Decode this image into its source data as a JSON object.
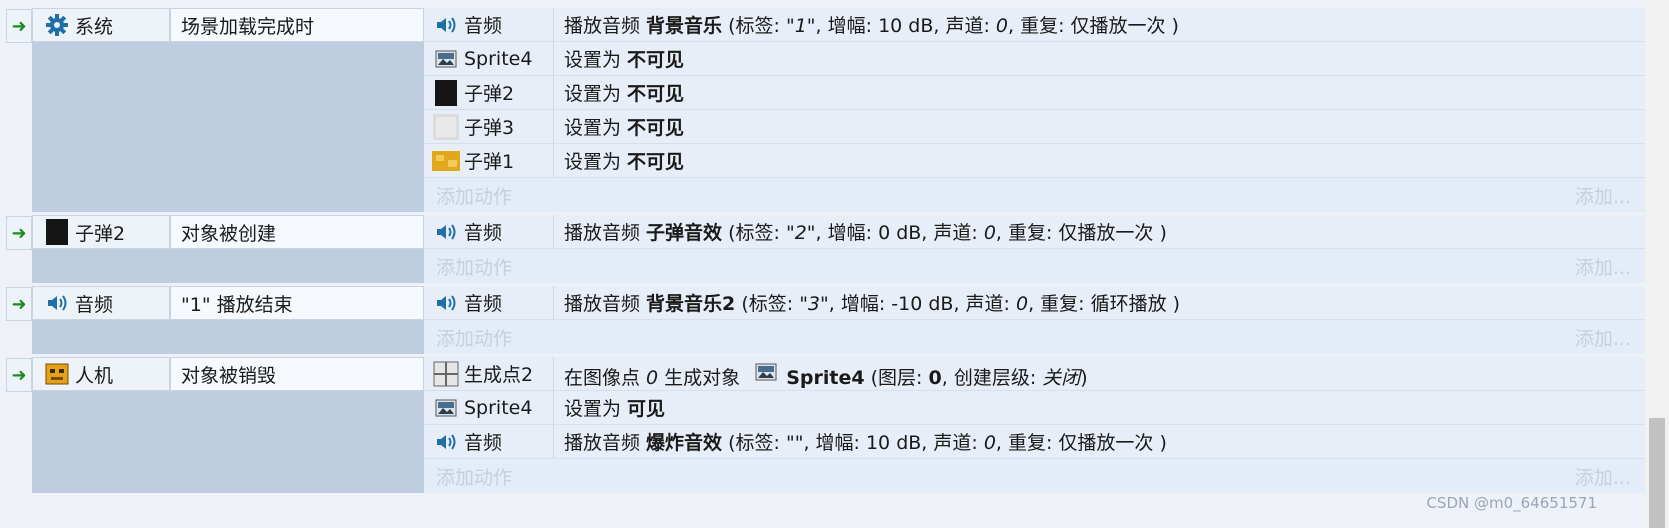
{
  "events": [
    {
      "object": "系统",
      "object_icon": "gear-icon",
      "condition": "场景加载完成时",
      "actions": [
        {
          "object": "音频",
          "icon": "speaker-icon",
          "parts": [
            {
              "t": "播放音频 "
            },
            {
              "b": "背景音乐"
            },
            {
              "t": " (标签: "
            },
            {
              "i": "\"1\""
            },
            {
              "t": ", 增幅: 10 dB, 声道: "
            },
            {
              "i": "0"
            },
            {
              "t": ", 重复: 仅播放一次 )"
            }
          ]
        },
        {
          "object": "Sprite4",
          "icon": "sprite-icon",
          "parts": [
            {
              "t": "设置为 "
            },
            {
              "b": "不可见"
            }
          ]
        },
        {
          "object": "子弹2",
          "icon": "black-square-icon",
          "parts": [
            {
              "t": "设置为 "
            },
            {
              "b": "不可见"
            }
          ]
        },
        {
          "object": "子弹3",
          "icon": "grey-square-icon",
          "parts": [
            {
              "t": "设置为 "
            },
            {
              "b": "不可见"
            }
          ]
        },
        {
          "object": "子弹1",
          "icon": "gold-square-icon",
          "parts": [
            {
              "t": "设置为 "
            },
            {
              "b": "不可见"
            }
          ]
        }
      ]
    },
    {
      "object": "子弹2",
      "object_icon": "black-square-icon",
      "condition": "对象被创建",
      "actions": [
        {
          "object": "音频",
          "icon": "speaker-icon",
          "parts": [
            {
              "t": "播放音频 "
            },
            {
              "b": "子弹音效"
            },
            {
              "t": " (标签: "
            },
            {
              "i": "\"2\""
            },
            {
              "t": ", 增幅: 0 dB, 声道: "
            },
            {
              "i": "0"
            },
            {
              "t": ", 重复: 仅播放一次 )"
            }
          ]
        }
      ]
    },
    {
      "object": "音频",
      "object_icon": "speaker-icon",
      "condition": "\"1\" 播放结束",
      "actions": [
        {
          "object": "音频",
          "icon": "speaker-icon",
          "parts": [
            {
              "t": "播放音频 "
            },
            {
              "b": "背景音乐2"
            },
            {
              "t": " (标签: "
            },
            {
              "i": "\"3\""
            },
            {
              "t": ", 增幅: -10 dB, 声道: "
            },
            {
              "i": "0"
            },
            {
              "t": ", 重复: 循环播放 )"
            }
          ]
        }
      ]
    },
    {
      "object": "人机",
      "object_icon": "robot-icon",
      "condition": "对象被销毁",
      "actions": [
        {
          "object": "生成点2",
          "icon": "grid-icon",
          "parts": [
            {
              "t": "在图像点 "
            },
            {
              "i": "0"
            },
            {
              "t": " 生成对象 "
            },
            {
              "icon": "sprite-icon"
            },
            {
              "b": "Sprite4"
            },
            {
              "t": " (图层: "
            },
            {
              "b": "0"
            },
            {
              "t": ", 创建层级: "
            },
            {
              "i": "关闭"
            },
            {
              "t": ")"
            }
          ]
        },
        {
          "object": "Sprite4",
          "icon": "sprite-icon",
          "parts": [
            {
              "t": "设置为 "
            },
            {
              "b": "可见"
            }
          ]
        },
        {
          "object": "音频",
          "icon": "speaker-icon",
          "parts": [
            {
              "t": "播放音频 "
            },
            {
              "b": "爆炸音效"
            },
            {
              "t": " (标签: "
            },
            {
              "i": "\"\""
            },
            {
              "t": ", 增幅: 10 dB, 声道: "
            },
            {
              "i": "0"
            },
            {
              "t": ", 重复: 仅播放一次 )"
            }
          ]
        }
      ]
    }
  ],
  "add_action_label": "添加动作",
  "add_label": "添加...",
  "watermark": "CSDN @m0_64651571",
  "colors": {
    "arrow": "#1d8a1d",
    "speaker": "#1f6fa8",
    "gear": "#1f6fa8"
  }
}
